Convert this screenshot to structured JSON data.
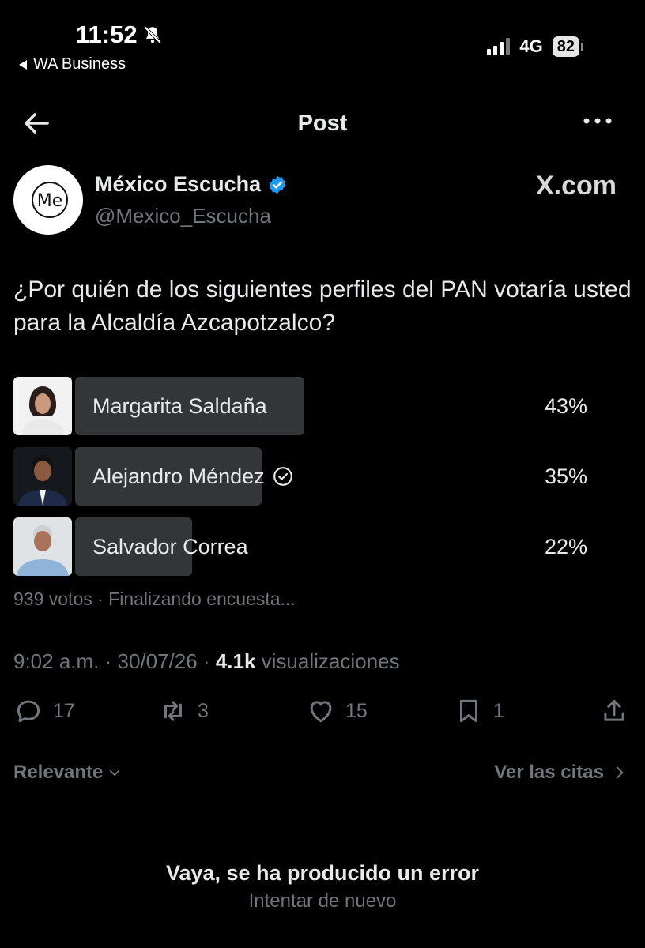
{
  "status_bar": {
    "time": "11:52",
    "back_app": "WA Business",
    "network": "4G",
    "battery": "82"
  },
  "nav": {
    "title": "Post"
  },
  "author": {
    "name": "México Escucha",
    "handle": "@Mexico_Escucha",
    "avatar_text": "Me",
    "watermark": "X.com"
  },
  "question": "¿Por quién de los siguientes perfiles del PAN votaría usted para la Alcaldía Azcapotzalco?",
  "poll": {
    "options": [
      {
        "label": "Margarita Saldaña",
        "percent_text": "43%",
        "percent": 43,
        "selected": false
      },
      {
        "label": "Alejandro Méndez",
        "percent_text": "35%",
        "percent": 35,
        "selected": true
      },
      {
        "label": "Salvador Correa",
        "percent_text": "22%",
        "percent": 22,
        "selected": false
      }
    ],
    "meta": "939 votos · Finalizando encuesta..."
  },
  "post_meta": {
    "time_date": "9:02 a.m. · 30/07/26 · ",
    "views_count": "4.1k",
    "views_label": " visualizaciones"
  },
  "actions": {
    "replies": "17",
    "reposts": "3",
    "likes": "15",
    "bookmarks": "1"
  },
  "replies_header": {
    "sort_label": "Relevante",
    "quotes_label": "Ver las citas"
  },
  "error": {
    "title": "Vaya, se ha producido un error",
    "retry": "Intentar de nuevo"
  },
  "colors": {
    "background": "#000000",
    "text": "#e7e9ea",
    "muted": "#71767b",
    "poll_bar": "#333639",
    "verified": "#1d9bf0",
    "brand_green": "#2bb24c"
  }
}
